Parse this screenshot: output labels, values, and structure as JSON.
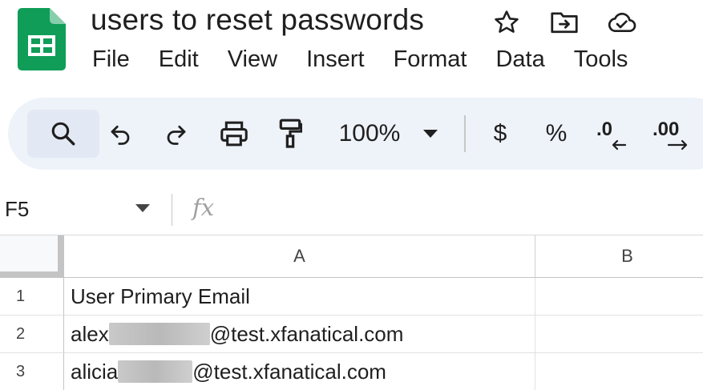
{
  "app": {
    "doc_title": "users to reset passwords",
    "brand_color": "#0f9d58"
  },
  "menu": {
    "items": [
      "File",
      "Edit",
      "View",
      "Insert",
      "Format",
      "Data",
      "Tools"
    ]
  },
  "toolbar": {
    "zoom": "100%",
    "currency": "$",
    "percent": "%",
    "decrease_decimal": ".0",
    "increase_decimal": ".00"
  },
  "formula_bar": {
    "name_box": "F5",
    "fx": "fx",
    "content": ""
  },
  "grid": {
    "columns": [
      "A",
      "B"
    ],
    "rows": [
      {
        "num": "1",
        "a_before": "User Primary Email",
        "a_after": "",
        "redacted": false
      },
      {
        "num": "2",
        "a_before": "alex",
        "a_after": "@test.xfanatical.com",
        "redacted": true
      },
      {
        "num": "3",
        "a_before": "alicia",
        "a_after": "@test.xfanatical.com",
        "redacted": true
      }
    ]
  }
}
